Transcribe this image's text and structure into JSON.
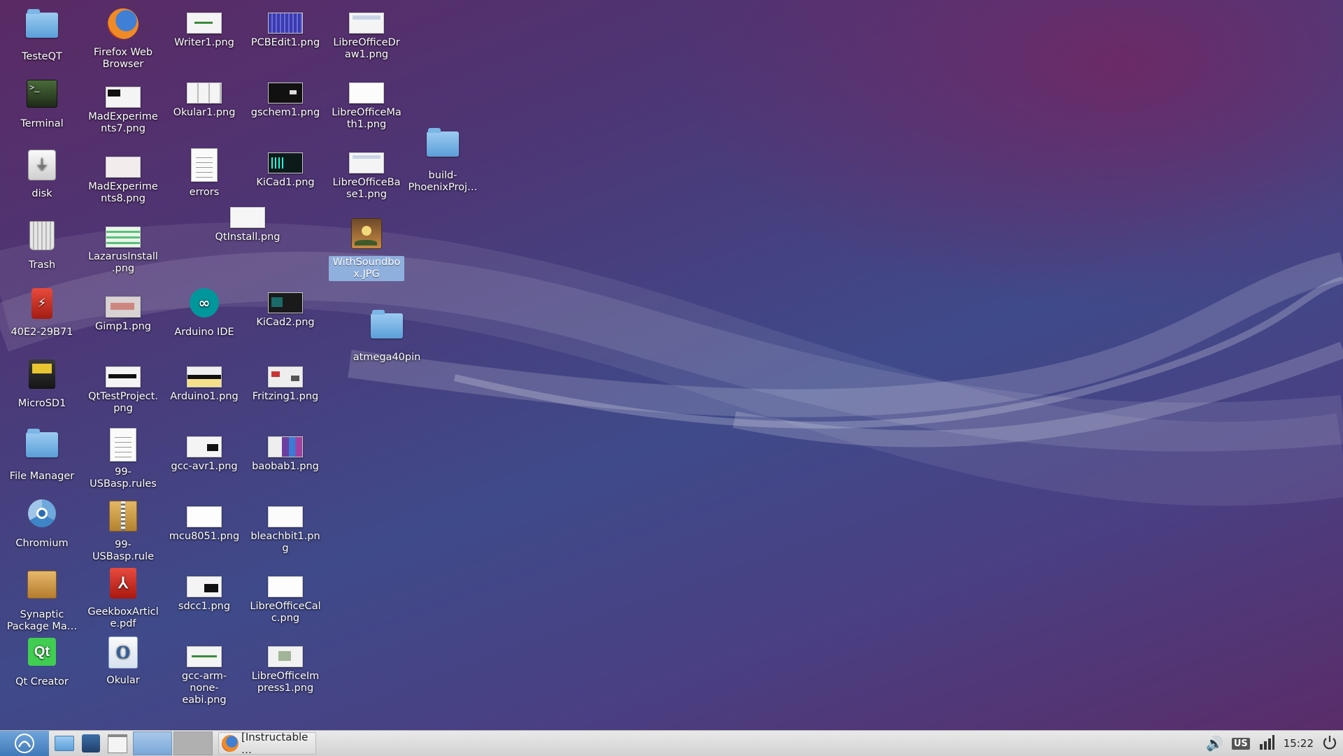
{
  "desktop": {
    "icons": [
      {
        "id": "testeqt",
        "label": "TesteQT"
      },
      {
        "id": "firefox",
        "label": "Firefox Web Browser"
      },
      {
        "id": "writer1",
        "label": "Writer1.png"
      },
      {
        "id": "pcbedit1",
        "label": "PCBEdit1.png"
      },
      {
        "id": "lodraw1",
        "label": "LibreOfficeDraw1.png"
      },
      {
        "id": "terminal",
        "label": "Terminal"
      },
      {
        "id": "madexp7",
        "label": "MadExperiments7.png"
      },
      {
        "id": "okular1",
        "label": "Okular1.png"
      },
      {
        "id": "gschem1",
        "label": "gschem1.png"
      },
      {
        "id": "lomath1",
        "label": "LibreOfficeMath1.png"
      },
      {
        "id": "build",
        "label": "build-PhoenixProj…"
      },
      {
        "id": "disk",
        "label": "disk"
      },
      {
        "id": "madexp8",
        "label": "MadExperiments8.png"
      },
      {
        "id": "errors",
        "label": "errors"
      },
      {
        "id": "kicad1",
        "label": "KiCad1.png"
      },
      {
        "id": "lobase1",
        "label": "LibreOfficeBase1.png"
      },
      {
        "id": "qtinstall",
        "label": "QtInstall.png"
      },
      {
        "id": "trash",
        "label": "Trash"
      },
      {
        "id": "lazarus",
        "label": "LazarusInstall.png"
      },
      {
        "id": "withsoundbox",
        "label": "WithSoundbox.JPG"
      },
      {
        "id": "usbdrive",
        "label": "40E2-29B71"
      },
      {
        "id": "gimp1",
        "label": "Gimp1.png"
      },
      {
        "id": "arduinoide",
        "label": "Arduino IDE"
      },
      {
        "id": "kicad2",
        "label": "KiCad2.png"
      },
      {
        "id": "atmega40pin",
        "label": "atmega40pin"
      },
      {
        "id": "microsd1",
        "label": "MicroSD1"
      },
      {
        "id": "qttestproject",
        "label": "QtTestProject.png"
      },
      {
        "id": "arduino1",
        "label": "Arduino1.png"
      },
      {
        "id": "fritzing1",
        "label": "Fritzing1.png"
      },
      {
        "id": "filemanager",
        "label": "File Manager"
      },
      {
        "id": "usbasprules",
        "label": "99-USBasp.rules"
      },
      {
        "id": "gccavr1",
        "label": "gcc-avr1.png"
      },
      {
        "id": "baobab1",
        "label": "baobab1.png"
      },
      {
        "id": "chromium",
        "label": "Chromium"
      },
      {
        "id": "usbasprules2",
        "label": "99-USBasp.rule…"
      },
      {
        "id": "mcu8051",
        "label": "mcu8051.png"
      },
      {
        "id": "bleachbit1",
        "label": "bleachbit1.png"
      },
      {
        "id": "synaptic",
        "label": "Synaptic Package Ma…"
      },
      {
        "id": "geekbox",
        "label": "GeekboxArticle.pdf"
      },
      {
        "id": "sdcc1",
        "label": "sdcc1.png"
      },
      {
        "id": "localc",
        "label": "LibreOfficeCalc.png"
      },
      {
        "id": "qtcreator",
        "label": "Qt Creator"
      },
      {
        "id": "okular",
        "label": "Okular"
      },
      {
        "id": "gccarm",
        "label": "gcc-arm-none-eabi.png"
      },
      {
        "id": "loimpress1",
        "label": "LibreOfficeImpress1.png"
      }
    ]
  },
  "taskbar": {
    "task_label": "[Instructable …",
    "keyboard_layout": "US",
    "clock": "15:22"
  },
  "colors": {
    "selection": "#9bbbe3",
    "panel": "#dcdcdc"
  }
}
